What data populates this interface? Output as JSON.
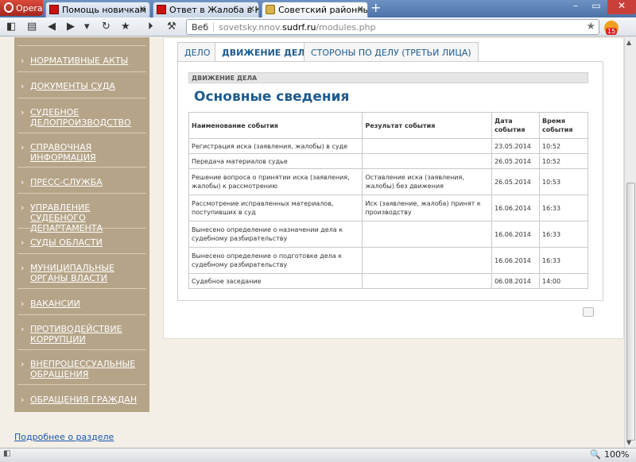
{
  "browser": {
    "menu_label": "Opera",
    "tabs": [
      {
        "title": "Помощь новичкам - ..."
      },
      {
        "title": "Ответ в Жалоба в Ква..."
      },
      {
        "title": "Советский районный ..."
      }
    ],
    "address": {
      "web_label": "Веб",
      "url_prefix": "sovetsky.nnov.",
      "url_domain": "sudrf.ru",
      "url_path": "/modules.php"
    },
    "notification_count": "15",
    "zoom": "100%"
  },
  "sidebar": {
    "items": [
      {
        "label": "НОРМАТИВНЫЕ АКТЫ"
      },
      {
        "label": "ДОКУМЕНТЫ СУДА"
      },
      {
        "label": "СУДЕБНОЕ ДЕЛОПРОИЗВОДСТВО"
      },
      {
        "label": "СПРАВОЧНАЯ ИНФОРМАЦИЯ"
      },
      {
        "label": "ПРЕСС-СЛУЖБА"
      },
      {
        "label": "УПРАВЛЕНИЕ СУДЕБНОГО ДЕПАРТАМЕНТА"
      },
      {
        "label": "СУДЫ ОБЛАСТИ"
      },
      {
        "label": "МУНИЦИПАЛЬНЫЕ ОРГАНЫ ВЛАСТИ"
      },
      {
        "label": "ВАКАНСИИ"
      },
      {
        "label": "ПРОТИВОДЕЙСТВИЕ КОРРУПЦИИ"
      },
      {
        "label": "ВНЕПРОЦЕССУАЛЬНЫЕ ОБРАЩЕНИЯ"
      },
      {
        "label": "ОБРАЩЕНИЯ ГРАЖДАН"
      }
    ],
    "more_link": "Подробнее о разделе"
  },
  "content": {
    "tabs": [
      {
        "label": "ДЕЛО"
      },
      {
        "label": "ДВИЖЕНИЕ ДЕЛА"
      },
      {
        "label": "СТОРОНЫ ПО ДЕЛУ (ТРЕТЬИ ЛИЦА)"
      }
    ],
    "panel_header": "ДВИЖЕНИЕ ДЕЛА",
    "panel_title": "Основные сведения",
    "table": {
      "headers": [
        "Наименование события",
        "Результат события",
        "Дата события",
        "Время события"
      ],
      "rows": [
        [
          "Регистрация иска (заявления, жалобы) в суде",
          "",
          "23.05.2014",
          "10:52"
        ],
        [
          "Передача материалов судье",
          "",
          "26.05.2014",
          "10:52"
        ],
        [
          "Решение вопроса о принятии иска (заявления, жалобы) к рассмотрению",
          "Оставление иска (заявления, жалобы) без движения",
          "26.05.2014",
          "10:53"
        ],
        [
          "Рассмотрение исправленных материалов, поступивших в суд",
          "Иск (заявление, жалоба) принят к производству",
          "16.06.2014",
          "16:33"
        ],
        [
          "Вынесено определение о назначении дела к судебному разбирательству",
          "",
          "16.06.2014",
          "16:33"
        ],
        [
          "Вынесено определение о подготовке дела к судебному разбирательству",
          "",
          "16.06.2014",
          "16:33"
        ],
        [
          "Судебное заседание",
          "",
          "06.08.2014",
          "14:00"
        ]
      ]
    }
  }
}
